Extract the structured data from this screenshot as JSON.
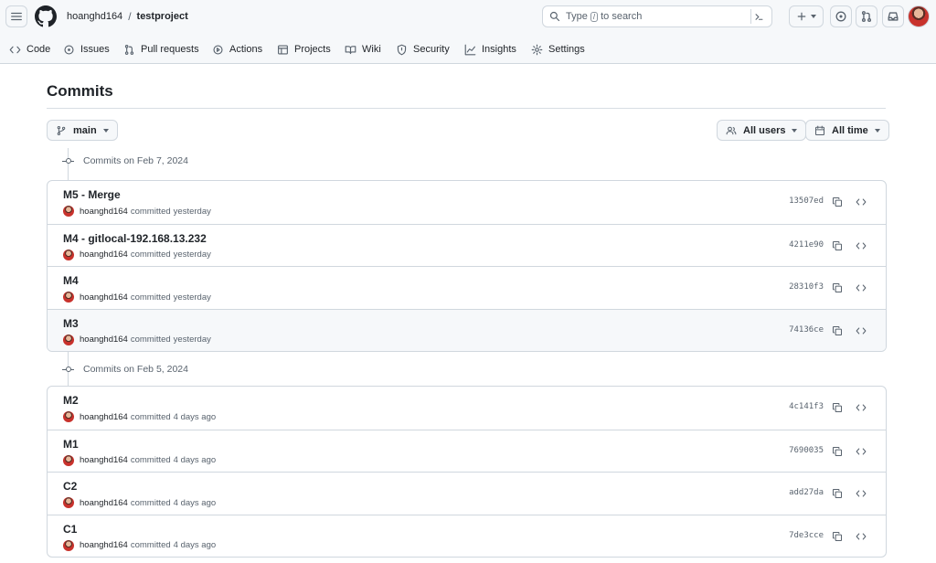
{
  "header": {
    "owner": "hoanghd164",
    "separator": "/",
    "repo": "testproject",
    "search": {
      "before": "Type",
      "key": "/",
      "after": "to search"
    }
  },
  "nav_tabs": [
    {
      "label": "Code",
      "icon": "code-icon"
    },
    {
      "label": "Issues",
      "icon": "issue-icon"
    },
    {
      "label": "Pull requests",
      "icon": "pull-request-icon"
    },
    {
      "label": "Actions",
      "icon": "play-icon"
    },
    {
      "label": "Projects",
      "icon": "table-icon"
    },
    {
      "label": "Wiki",
      "icon": "book-icon"
    },
    {
      "label": "Security",
      "icon": "shield-icon"
    },
    {
      "label": "Insights",
      "icon": "graph-icon"
    },
    {
      "label": "Settings",
      "icon": "gear-icon"
    }
  ],
  "page": {
    "title": "Commits",
    "branch": "main",
    "users_filter": "All users",
    "time_filter": "All time"
  },
  "commit_groups": [
    {
      "heading": "Commits on Feb 7, 2024",
      "commits": [
        {
          "message": "M5 - Merge",
          "author": "hoanghd164",
          "action": "committed",
          "when": "yesterday",
          "sha": "13507ed"
        },
        {
          "message": "M4 - gitlocal-192.168.13.232",
          "author": "hoanghd164",
          "action": "committed",
          "when": "yesterday",
          "sha": "4211e90"
        },
        {
          "message": "M4",
          "author": "hoanghd164",
          "action": "committed",
          "when": "yesterday",
          "sha": "28310f3"
        },
        {
          "message": "M3",
          "author": "hoanghd164",
          "action": "committed",
          "when": "yesterday",
          "sha": "74136ce"
        }
      ]
    },
    {
      "heading": "Commits on Feb 5, 2024",
      "commits": [
        {
          "message": "M2",
          "author": "hoanghd164",
          "action": "committed",
          "when": "4 days ago",
          "sha": "4c141f3"
        },
        {
          "message": "M1",
          "author": "hoanghd164",
          "action": "committed",
          "when": "4 days ago",
          "sha": "7690035"
        },
        {
          "message": "C2",
          "author": "hoanghd164",
          "action": "committed",
          "when": "4 days ago",
          "sha": "add27da"
        },
        {
          "message": "C1",
          "author": "hoanghd164",
          "action": "committed",
          "when": "4 days ago",
          "sha": "7de3cce"
        }
      ]
    }
  ]
}
